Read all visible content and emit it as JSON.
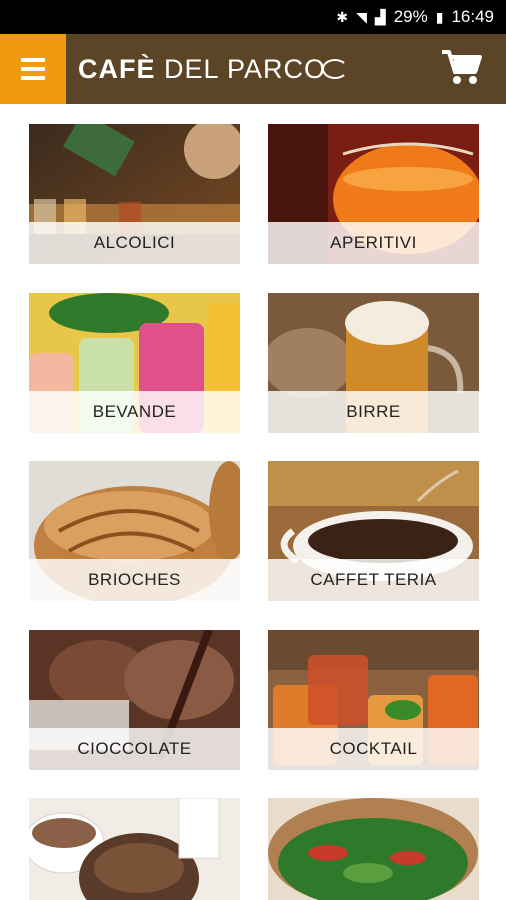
{
  "status_bar": {
    "battery": "29%",
    "time": "16:49"
  },
  "header": {
    "logo_bold": "CAFÈ",
    "logo_rest": "DEL PARCO"
  },
  "icons": {
    "menu": "hamburger-menu-icon",
    "cart": "shopping-cart-icon"
  },
  "colors": {
    "header_bg": "#5b4526",
    "menu_bg": "#f29a0e"
  },
  "categories": [
    {
      "label": "ALCOLICI"
    },
    {
      "label": "APERITIVI"
    },
    {
      "label": "BEVANDE"
    },
    {
      "label": "BIRRE"
    },
    {
      "label": "BRIOCHES"
    },
    {
      "label": "CAFFET TERIA"
    },
    {
      "label": "CIOCCOLATE"
    },
    {
      "label": "COCKTAIL"
    },
    {
      "label": ""
    },
    {
      "label": ""
    }
  ]
}
